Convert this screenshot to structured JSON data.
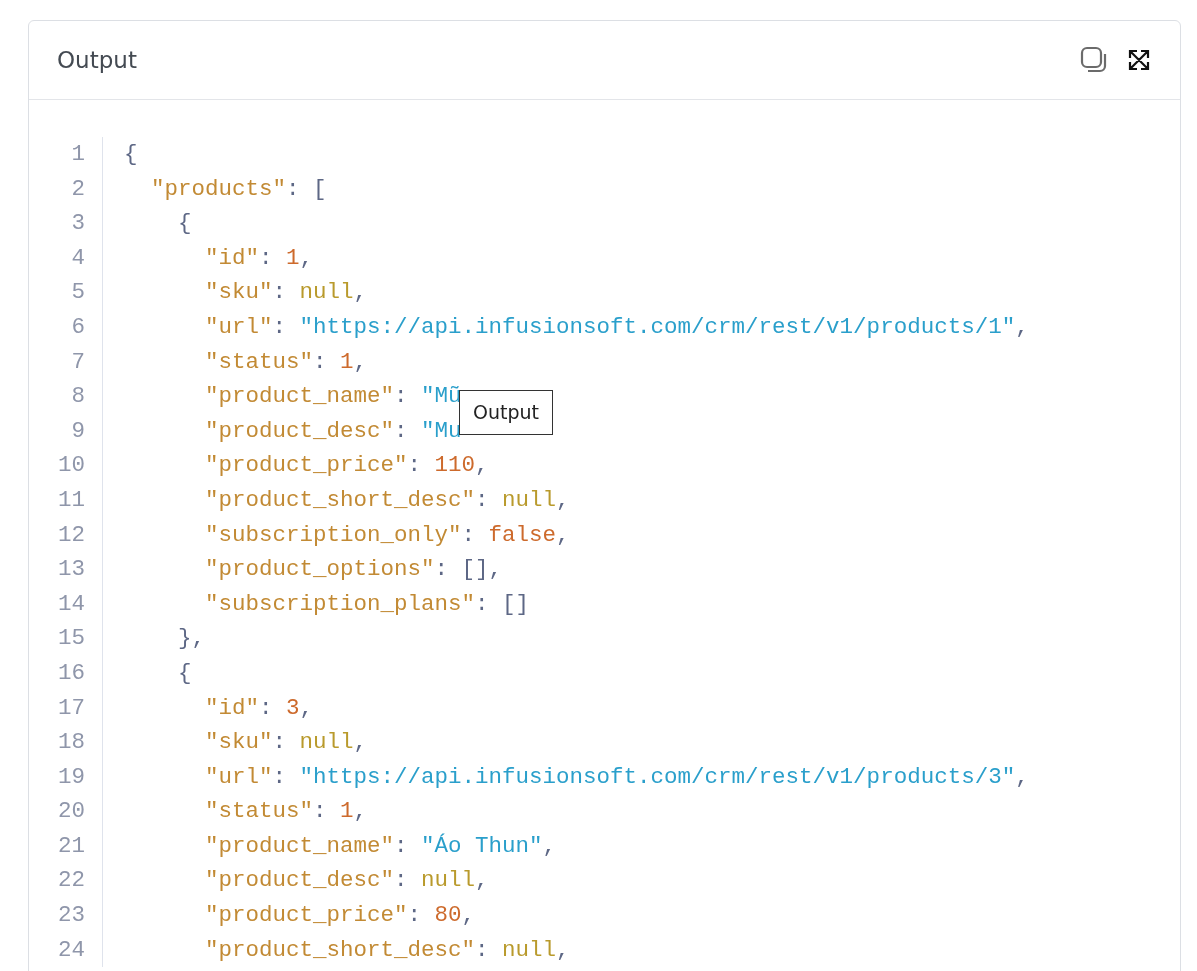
{
  "panel": {
    "title": "Output"
  },
  "tooltip": {
    "text": "Output"
  },
  "code": [
    {
      "number": "1",
      "tokens": [
        {
          "kind": "punct",
          "text": "{"
        }
      ]
    },
    {
      "number": "2",
      "tokens": [
        {
          "kind": "key",
          "text": "\"products\""
        },
        {
          "kind": "punct",
          "text": ": ["
        }
      ]
    },
    {
      "number": "3",
      "tokens": [
        {
          "kind": "punct",
          "text": "{"
        }
      ]
    },
    {
      "number": "4",
      "tokens": [
        {
          "kind": "key",
          "text": "\"id\""
        },
        {
          "kind": "punct",
          "text": ": "
        },
        {
          "kind": "num",
          "text": "1"
        },
        {
          "kind": "punct",
          "text": ","
        }
      ]
    },
    {
      "number": "5",
      "tokens": [
        {
          "kind": "key",
          "text": "\"sku\""
        },
        {
          "kind": "punct",
          "text": ": "
        },
        {
          "kind": "null",
          "text": "null"
        },
        {
          "kind": "punct",
          "text": ","
        }
      ]
    },
    {
      "number": "6",
      "tokens": [
        {
          "kind": "key",
          "text": "\"url\""
        },
        {
          "kind": "punct",
          "text": ": "
        },
        {
          "kind": "str",
          "text": "\"https://api.infusionsoft.com/crm/rest/v1/products/1\""
        },
        {
          "kind": "punct",
          "text": ","
        }
      ]
    },
    {
      "number": "7",
      "tokens": [
        {
          "kind": "key",
          "text": "\"status\""
        },
        {
          "kind": "punct",
          "text": ": "
        },
        {
          "kind": "num",
          "text": "1"
        },
        {
          "kind": "punct",
          "text": ","
        }
      ]
    },
    {
      "number": "8",
      "tokens": [
        {
          "kind": "key",
          "text": "\"product_name\""
        },
        {
          "kind": "punct",
          "text": ": "
        },
        {
          "kind": "str",
          "text": "\"Mũ"
        }
      ]
    },
    {
      "number": "9",
      "tokens": [
        {
          "kind": "key",
          "text": "\"product_desc\""
        },
        {
          "kind": "punct",
          "text": ": "
        },
        {
          "kind": "str",
          "text": "\"Mu"
        }
      ]
    },
    {
      "number": "10",
      "tokens": [
        {
          "kind": "key",
          "text": "\"product_price\""
        },
        {
          "kind": "punct",
          "text": ": "
        },
        {
          "kind": "num",
          "text": "110"
        },
        {
          "kind": "punct",
          "text": ","
        }
      ]
    },
    {
      "number": "11",
      "tokens": [
        {
          "kind": "key",
          "text": "\"product_short_desc\""
        },
        {
          "kind": "punct",
          "text": ": "
        },
        {
          "kind": "null",
          "text": "null"
        },
        {
          "kind": "punct",
          "text": ","
        }
      ]
    },
    {
      "number": "12",
      "tokens": [
        {
          "kind": "key",
          "text": "\"subscription_only\""
        },
        {
          "kind": "punct",
          "text": ": "
        },
        {
          "kind": "num",
          "text": "false"
        },
        {
          "kind": "punct",
          "text": ","
        }
      ]
    },
    {
      "number": "13",
      "tokens": [
        {
          "kind": "key",
          "text": "\"product_options\""
        },
        {
          "kind": "punct",
          "text": ": [],"
        }
      ]
    },
    {
      "number": "14",
      "tokens": [
        {
          "kind": "key",
          "text": "\"subscription_plans\""
        },
        {
          "kind": "punct",
          "text": ": []"
        }
      ]
    },
    {
      "number": "15",
      "tokens": [
        {
          "kind": "punct",
          "text": "},"
        }
      ]
    },
    {
      "number": "16",
      "tokens": [
        {
          "kind": "punct",
          "text": "{"
        }
      ]
    },
    {
      "number": "17",
      "tokens": [
        {
          "kind": "key",
          "text": "\"id\""
        },
        {
          "kind": "punct",
          "text": ": "
        },
        {
          "kind": "num",
          "text": "3"
        },
        {
          "kind": "punct",
          "text": ","
        }
      ]
    },
    {
      "number": "18",
      "tokens": [
        {
          "kind": "key",
          "text": "\"sku\""
        },
        {
          "kind": "punct",
          "text": ": "
        },
        {
          "kind": "null",
          "text": "null"
        },
        {
          "kind": "punct",
          "text": ","
        }
      ]
    },
    {
      "number": "19",
      "tokens": [
        {
          "kind": "key",
          "text": "\"url\""
        },
        {
          "kind": "punct",
          "text": ": "
        },
        {
          "kind": "str",
          "text": "\"https://api.infusionsoft.com/crm/rest/v1/products/3\""
        },
        {
          "kind": "punct",
          "text": ","
        }
      ]
    },
    {
      "number": "20",
      "tokens": [
        {
          "kind": "key",
          "text": "\"status\""
        },
        {
          "kind": "punct",
          "text": ": "
        },
        {
          "kind": "num",
          "text": "1"
        },
        {
          "kind": "punct",
          "text": ","
        }
      ]
    },
    {
      "number": "21",
      "tokens": [
        {
          "kind": "key",
          "text": "\"product_name\""
        },
        {
          "kind": "punct",
          "text": ": "
        },
        {
          "kind": "str",
          "text": "\"Áo Thun\""
        },
        {
          "kind": "punct",
          "text": ","
        }
      ]
    },
    {
      "number": "22",
      "tokens": [
        {
          "kind": "key",
          "text": "\"product_desc\""
        },
        {
          "kind": "punct",
          "text": ": "
        },
        {
          "kind": "null",
          "text": "null"
        },
        {
          "kind": "punct",
          "text": ","
        }
      ]
    },
    {
      "number": "23",
      "tokens": [
        {
          "kind": "key",
          "text": "\"product_price\""
        },
        {
          "kind": "punct",
          "text": ": "
        },
        {
          "kind": "num",
          "text": "80"
        },
        {
          "kind": "punct",
          "text": ","
        }
      ]
    },
    {
      "number": "24",
      "tokens": [
        {
          "kind": "key",
          "text": "\"product_short_desc\""
        },
        {
          "kind": "punct",
          "text": ": "
        },
        {
          "kind": "null",
          "text": "null"
        },
        {
          "kind": "punct",
          "text": ","
        }
      ]
    }
  ]
}
